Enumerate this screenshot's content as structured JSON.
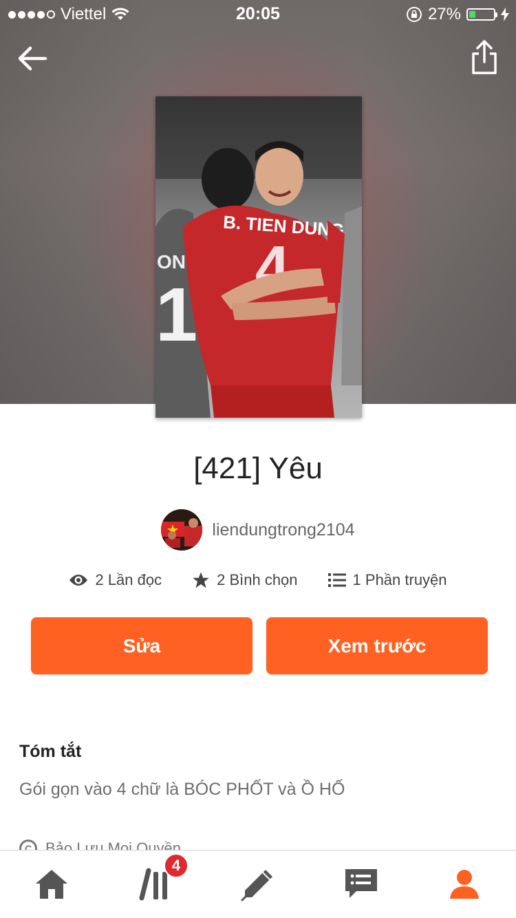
{
  "status_bar": {
    "carrier": "Viettel",
    "time": "20:05",
    "battery_percent": "27%",
    "battery_level": 0.27,
    "signal_bars_filled": 4,
    "signal_bars_total": 5
  },
  "story": {
    "title": "[421] Yêu",
    "author": "liendungtrong2104",
    "stats": {
      "reads": "2 Lần đọc",
      "votes": "2 Bình chọn",
      "parts": "1 Phần truyện"
    }
  },
  "actions": {
    "edit_label": "Sửa",
    "preview_label": "Xem trước"
  },
  "summary": {
    "heading": "Tóm tắt",
    "text": "Gói gọn vào 4 chữ là BÓC PHỐT và Ồ HỐ",
    "copyright": "Bảo Lưu Mọi Quyền"
  },
  "tabbar": {
    "library_badge": "4"
  },
  "icons": {
    "back": "back-arrow-icon",
    "share": "share-icon",
    "reads": "eye-icon",
    "votes": "star-icon",
    "parts": "list-icon",
    "home": "home-icon",
    "library": "library-icon",
    "write": "pencil-icon",
    "messages": "chat-icon",
    "profile": "user-icon"
  },
  "colors": {
    "accent": "#ff6122",
    "badge": "#e0282f",
    "active_tab": "#ff6122",
    "inactive_tab": "#555555"
  }
}
